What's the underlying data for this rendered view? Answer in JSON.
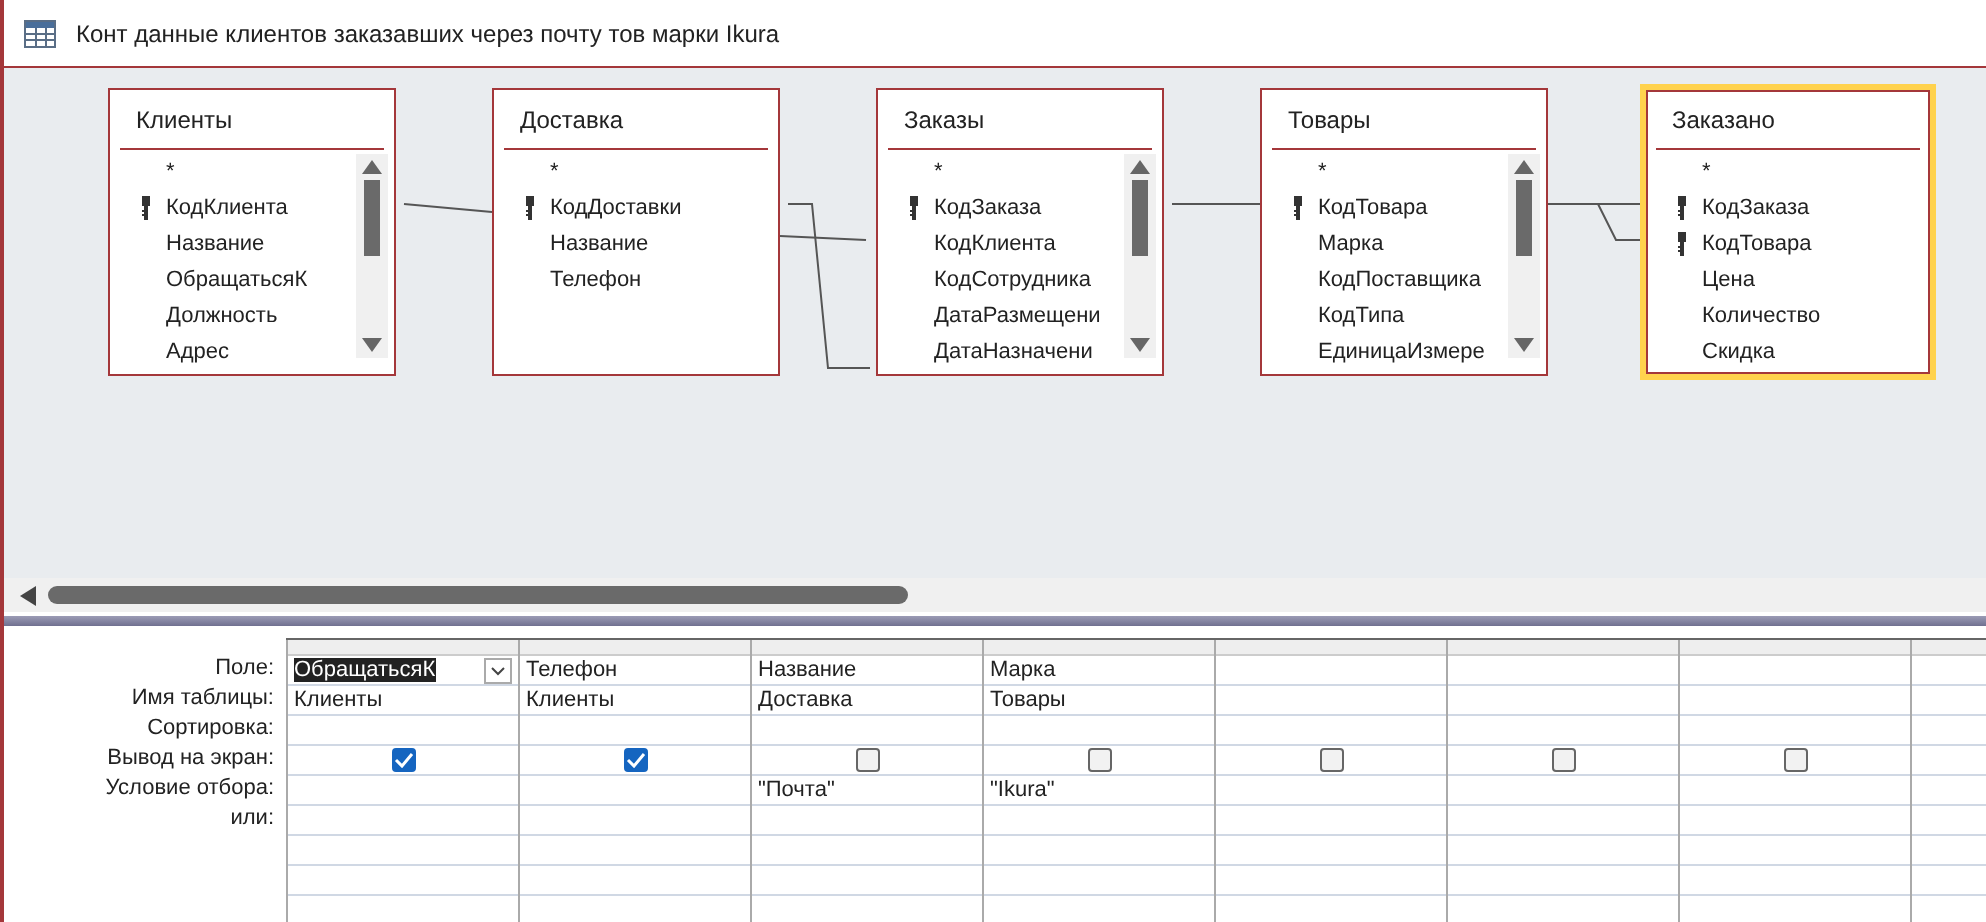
{
  "window": {
    "title": "Конт данные клиентов заказавших через почту тов марки Ikura"
  },
  "tables": [
    {
      "name": "Клиенты",
      "selected": false,
      "scrollbar": true,
      "fields": [
        {
          "name": "*",
          "key": false
        },
        {
          "name": "КодКлиента",
          "key": true
        },
        {
          "name": "Название",
          "key": false
        },
        {
          "name": "ОбращатьсяК",
          "key": false
        },
        {
          "name": "Должность",
          "key": false
        },
        {
          "name": "Адрес",
          "key": false
        }
      ]
    },
    {
      "name": "Доставка",
      "selected": false,
      "scrollbar": false,
      "fields": [
        {
          "name": "*",
          "key": false
        },
        {
          "name": "КодДоставки",
          "key": true
        },
        {
          "name": "Название",
          "key": false
        },
        {
          "name": "Телефон",
          "key": false
        }
      ]
    },
    {
      "name": "Заказы",
      "selected": false,
      "scrollbar": true,
      "fields": [
        {
          "name": "*",
          "key": false
        },
        {
          "name": "КодЗаказа",
          "key": true
        },
        {
          "name": "КодКлиента",
          "key": false
        },
        {
          "name": "КодСотрудника",
          "key": false
        },
        {
          "name": "ДатаРазмещени",
          "key": false
        },
        {
          "name": "ДатаНазначени",
          "key": false
        }
      ]
    },
    {
      "name": "Товары",
      "selected": false,
      "scrollbar": true,
      "fields": [
        {
          "name": "*",
          "key": false
        },
        {
          "name": "КодТовара",
          "key": true
        },
        {
          "name": "Марка",
          "key": false
        },
        {
          "name": "КодПоставщика",
          "key": false
        },
        {
          "name": "КодТипа",
          "key": false
        },
        {
          "name": "ЕдиницаИзмере",
          "key": false
        }
      ]
    },
    {
      "name": "Заказано",
      "selected": true,
      "scrollbar": false,
      "fields": [
        {
          "name": "*",
          "key": false
        },
        {
          "name": "КодЗаказа",
          "key": true
        },
        {
          "name": "КодТовара",
          "key": true
        },
        {
          "name": "Цена",
          "key": false
        },
        {
          "name": "Количество",
          "key": false
        },
        {
          "name": "Скидка",
          "key": false
        }
      ]
    }
  ],
  "grid": {
    "row_labels": [
      "Поле:",
      "Имя таблицы:",
      "Сортировка:",
      "Вывод на экран:",
      "Условие отбора:",
      "или:"
    ],
    "columns": [
      {
        "field": "ОбращатьсяК",
        "table": "Клиенты",
        "show": true,
        "selected": true
      },
      {
        "field": "Телефон",
        "table": "Клиенты",
        "show": true,
        "selected": false
      },
      {
        "field": "Название",
        "table": "Доставка",
        "show": false,
        "criteria": "\"Почта\"",
        "selected": false
      },
      {
        "field": "Марка",
        "table": "Товары",
        "show": false,
        "criteria": "\"Ikura\"",
        "selected": false
      },
      {
        "show": false,
        "selected": false
      },
      {
        "show": false,
        "selected": false
      },
      {
        "show": false,
        "selected": false
      }
    ]
  }
}
